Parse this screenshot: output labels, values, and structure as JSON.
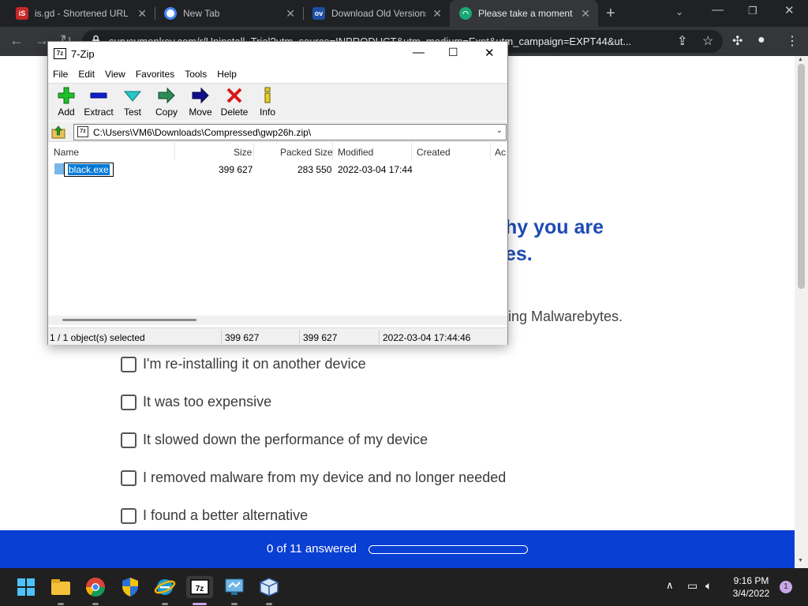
{
  "browser": {
    "tabs": [
      {
        "title": "is.gd - Shortened URL",
        "favicon": "isgd-favicon"
      },
      {
        "title": "New Tab",
        "favicon": "chrome-favicon"
      },
      {
        "title": "Download Old Versions",
        "favicon": "oldversion-favicon"
      },
      {
        "title": "Please take a moment",
        "favicon": "surveymonkey-favicon"
      }
    ],
    "new_tab_glyph": "+",
    "url": "surveymonkey.com/r/Uninstall_Trial?utm_source=INPRODUCT&utm_medium=Expt&utm_campaign=EXPT44&ut..."
  },
  "page": {
    "question_title_line1": "hy you are",
    "question_title_line2": "es.",
    "question_subtitle": "ling Malwarebytes.",
    "options": [
      "I'm re-installing it on another device",
      "It was too expensive",
      "It slowed down the performance of my device",
      "I removed malware from my device and no longer needed",
      "I found a better alternative"
    ],
    "progress_text": "0 of 11 answered",
    "progress_fraction": 0
  },
  "sevenzip": {
    "title": "7-Zip",
    "app_icon_text": "7z",
    "menu": [
      "File",
      "Edit",
      "View",
      "Favorites",
      "Tools",
      "Help"
    ],
    "toolbar": [
      "Add",
      "Extract",
      "Test",
      "Copy",
      "Move",
      "Delete",
      "Info"
    ],
    "path": "C:\\Users\\VM6\\Downloads\\Compressed\\gwp26h.zip\\",
    "columns": [
      "Name",
      "Size",
      "Packed Size",
      "Modified",
      "Created",
      "Ac"
    ],
    "file": {
      "name": "black.exe",
      "size": "399 627",
      "packed_size": "283 550",
      "modified": "2022-03-04 17:44"
    },
    "status": {
      "selection": "1 / 1 object(s) selected",
      "size": "399 627",
      "packed": "399 627",
      "modified": "2022-03-04 17:44:46"
    }
  },
  "taskbar": {
    "apps": [
      "start-icon",
      "file-explorer-icon",
      "chrome-icon",
      "security-shield-icon",
      "ie-icon",
      "7zip-icon",
      "network-tool-icon",
      "box-app-icon"
    ],
    "time": "9:16 PM",
    "date": "3/4/2022",
    "notification_count": "1"
  },
  "colors": {
    "brand_blue": "#1d4ab3",
    "progress_blue": "#0a3fd4",
    "selection_blue": "#0078d7"
  }
}
